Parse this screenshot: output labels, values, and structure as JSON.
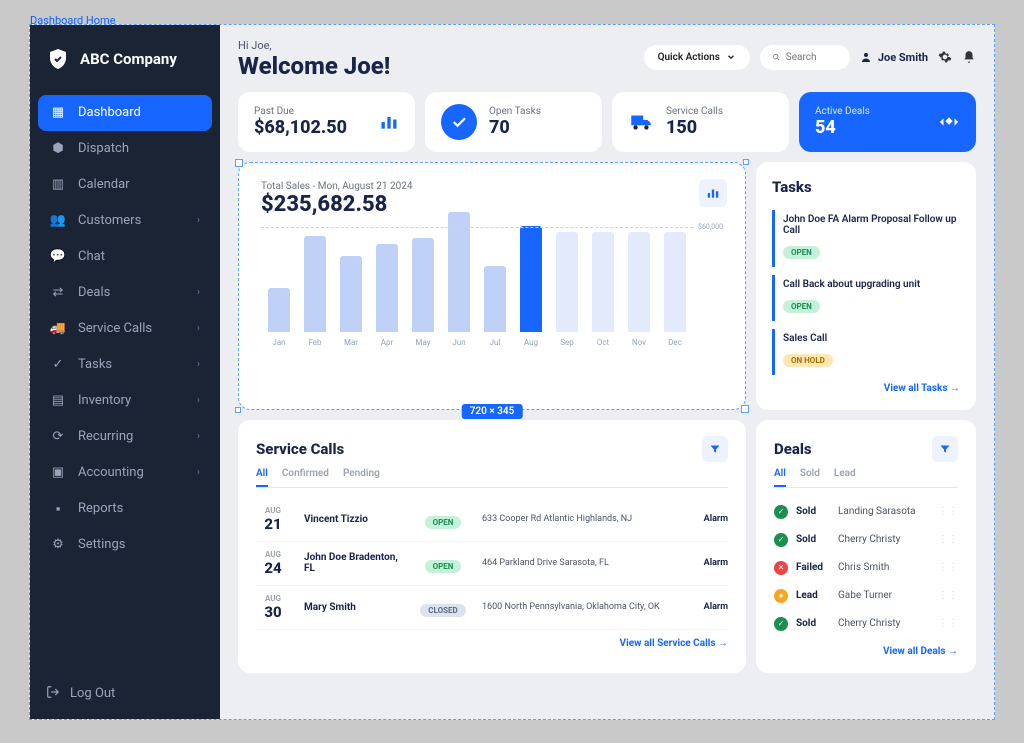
{
  "outer_label": "Dashboard Home",
  "brand": "ABC Company",
  "nav": [
    {
      "label": "Dashboard",
      "icon": "dashboard",
      "active": true,
      "chevron": false
    },
    {
      "label": "Dispatch",
      "icon": "map",
      "active": false,
      "chevron": false
    },
    {
      "label": "Calendar",
      "icon": "calendar",
      "active": false,
      "chevron": false
    },
    {
      "label": "Customers",
      "icon": "users",
      "active": false,
      "chevron": true
    },
    {
      "label": "Chat",
      "icon": "chat",
      "active": false,
      "chevron": false
    },
    {
      "label": "Deals",
      "icon": "deals",
      "active": false,
      "chevron": true
    },
    {
      "label": "Service Calls",
      "icon": "truck",
      "active": false,
      "chevron": true
    },
    {
      "label": "Tasks",
      "icon": "check",
      "active": false,
      "chevron": true
    },
    {
      "label": "Inventory",
      "icon": "inventory",
      "active": false,
      "chevron": true
    },
    {
      "label": "Recurring",
      "icon": "recurring",
      "active": false,
      "chevron": true
    },
    {
      "label": "Accounting",
      "icon": "accounting",
      "active": false,
      "chevron": true
    },
    {
      "label": "Reports",
      "icon": "reports",
      "active": false,
      "chevron": false
    },
    {
      "label": "Settings",
      "icon": "settings",
      "active": false,
      "chevron": false
    }
  ],
  "logout": "Log Out",
  "greeting_small": "Hi Joe,",
  "greeting_large": "Welcome Joe!",
  "quick_actions": "Quick Actions",
  "search_placeholder": "Search",
  "user_name": "Joe Smith",
  "cards": {
    "past_due": {
      "label": "Past Due",
      "value": "$68,102.50"
    },
    "open_tasks": {
      "label": "Open Tasks",
      "value": "70"
    },
    "service_calls": {
      "label": "Service Calls",
      "value": "150"
    },
    "active_deals": {
      "label": "Active Deals",
      "value": "54"
    }
  },
  "chart": {
    "title": "Total Sales - Mon, August 21 2024",
    "value": "$235,682.58",
    "ylabel": "$60,000",
    "dim": "720 × 345"
  },
  "chart_data": {
    "type": "bar",
    "title": "Total Sales - Mon, August 21 2024",
    "ylabel": "$",
    "ylim": [
      0,
      60000
    ],
    "categories": [
      "Jan",
      "Feb",
      "Mar",
      "Apr",
      "May",
      "Jun",
      "Jul",
      "Aug",
      "Sep",
      "Oct",
      "Nov",
      "Dec"
    ],
    "values": [
      22000,
      48000,
      38000,
      44000,
      47000,
      60000,
      33000,
      53000,
      50000,
      50000,
      50000,
      50000
    ],
    "highlight_index": 7
  },
  "tasks_panel": {
    "title": "Tasks",
    "items": [
      {
        "name": "John Doe FA Alarm Proposal Follow up Call",
        "status": "OPEN"
      },
      {
        "name": "Call Back about upgrading unit",
        "status": "OPEN"
      },
      {
        "name": "Sales Call",
        "status": "ON HOLD"
      }
    ],
    "view_all": "View all Tasks →"
  },
  "service_calls_panel": {
    "title": "Service Calls",
    "tabs": [
      "All",
      "Confirmed",
      "Pending"
    ],
    "active_tab": 0,
    "rows": [
      {
        "month": "AUG",
        "day": "21",
        "name": "Vincent Tizzio",
        "status": "OPEN",
        "addr": "633 Cooper Rd Atlantic Highlands, NJ",
        "type": "Alarm"
      },
      {
        "month": "AUG",
        "day": "24",
        "name": "John Doe Bradenton, FL",
        "status": "OPEN",
        "addr": "464 Parkland Drive Sarasota, FL",
        "type": "Alarm"
      },
      {
        "month": "AUG",
        "day": "30",
        "name": "Mary Smith",
        "status": "CLOSED",
        "addr": "1600 North Pennsylvania, Oklahoma City, OK",
        "type": "Alarm"
      }
    ],
    "view_all": "View all Service Calls →"
  },
  "deals_panel": {
    "title": "Deals",
    "tabs": [
      "All",
      "Sold",
      "Lead"
    ],
    "active_tab": 0,
    "rows": [
      {
        "status": "Sold",
        "name": "Landing Sarasota",
        "kind": "sold"
      },
      {
        "status": "Sold",
        "name": "Cherry Christy",
        "kind": "sold"
      },
      {
        "status": "Failed",
        "name": "Chris Smith",
        "kind": "failed"
      },
      {
        "status": "Lead",
        "name": "Gabe Turner",
        "kind": "lead"
      },
      {
        "status": "Sold",
        "name": "Cherry Christy",
        "kind": "sold"
      }
    ],
    "view_all": "View all Deals →"
  }
}
